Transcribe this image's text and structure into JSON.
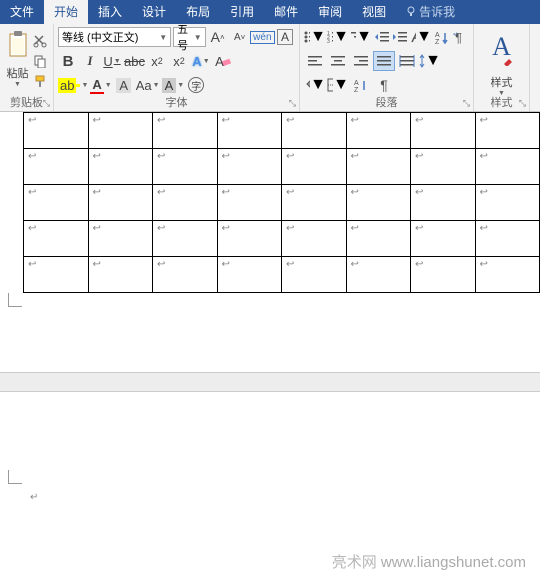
{
  "tabs": {
    "file": "文件",
    "home": "开始",
    "insert": "插入",
    "design": "设计",
    "layout": "布局",
    "references": "引用",
    "mailings": "邮件",
    "review": "审阅",
    "view": "视图",
    "tell_me": "告诉我"
  },
  "clipboard": {
    "paste": "粘贴",
    "group_label": "剪贴板"
  },
  "font": {
    "name": "等线 (中文正文)",
    "size": "五号",
    "group_label": "字体",
    "bold": "B",
    "italic": "I",
    "underline": "U",
    "strike": "abc",
    "sub": "x",
    "sup": "x",
    "grow": "A",
    "shrink": "A",
    "clear": "A",
    "wen": "wén",
    "char_a": "A",
    "phonetic": "A",
    "highlight": "ab",
    "color": "A",
    "border_char": "A",
    "circle_char": "字"
  },
  "paragraph": {
    "group_label": "段落",
    "sort": "A↓",
    "pilcrow": "¶"
  },
  "styles": {
    "letter": "A",
    "label": "样式",
    "group_label": "样式"
  },
  "table": {
    "rows": 5,
    "cols": 8,
    "cell_mark": "↩"
  },
  "footer": {
    "site_cn": "亮术网",
    "site_url": "www.liangshunet.com"
  }
}
